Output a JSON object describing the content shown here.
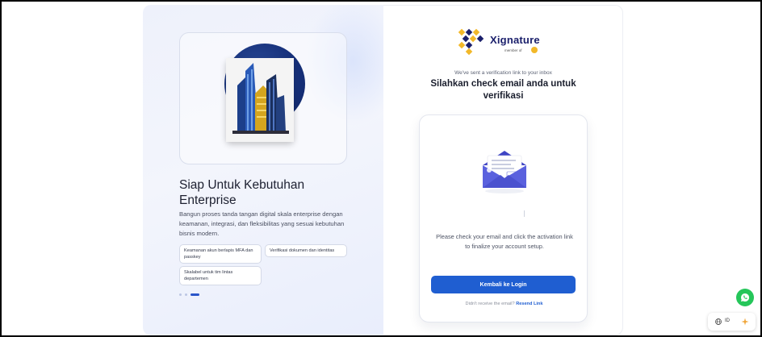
{
  "promo": {
    "title": "Siap Untuk Kebutuhan Enterprise",
    "description": "Bangun proses tanda tangan digital skala enterprise dengan keamanan, integrasi, dan fleksibilitas yang sesuai kebutuhan bisnis modern.",
    "features": [
      "Keamanan akun berlapis MFA dan passkey",
      "Verifikasi dokumen dan identitas",
      "Skalabel untuk tim lintas departemen"
    ],
    "carousel": {
      "count": 3,
      "active_index": 2
    }
  },
  "brand": {
    "name": "Xignature",
    "member_text": "member of",
    "colors": {
      "primary": "#1a1f6b",
      "accent": "#f2b829"
    }
  },
  "verification": {
    "subtitle": "We've sent a verification link to your inbox",
    "title": "Silahkan check email anda untuk verifikasi",
    "message": "Please check your email and click the activation link to finalize your account setup.",
    "button_label": "Kembali ke Login",
    "resend_prompt": "Didn't receive the email?",
    "resend_link": "Resend Link"
  },
  "widgets": {
    "whatsapp_icon": "whatsapp-icon",
    "language_code": "ID"
  },
  "colors": {
    "button": "#1f5ed1",
    "whatsapp": "#25c65a"
  }
}
